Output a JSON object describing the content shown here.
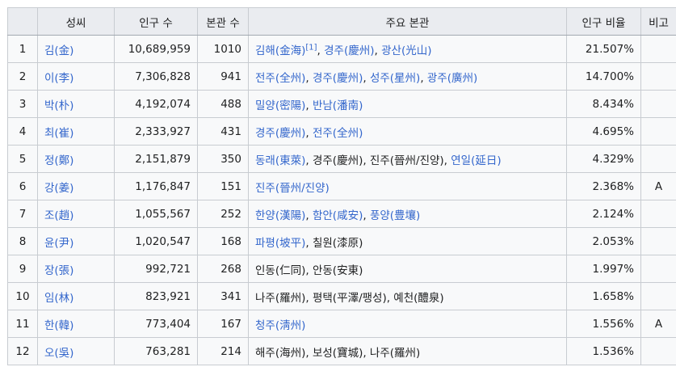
{
  "headers": [
    "",
    "성씨",
    "인구 수",
    "본관 수",
    "주요 본관",
    "인구 비율",
    "비고"
  ],
  "rows": [
    {
      "rank": "1",
      "surname": "김(金)",
      "population": "10,689,959",
      "bongwan_count": "1010",
      "main": [
        {
          "t": "김해(金海)",
          "link": true,
          "sup": "[1]"
        },
        {
          "t": ", "
        },
        {
          "t": "경주(慶州)",
          "link": true
        },
        {
          "t": ", "
        },
        {
          "t": "광산(光山)",
          "link": true
        }
      ],
      "ratio": "21.507%",
      "note": ""
    },
    {
      "rank": "2",
      "surname": "이(李)",
      "population": "7,306,828",
      "bongwan_count": "941",
      "main": [
        {
          "t": "전주(全州)",
          "link": true
        },
        {
          "t": ", "
        },
        {
          "t": "경주(慶州)",
          "link": true
        },
        {
          "t": ", "
        },
        {
          "t": "성주(星州)",
          "link": true
        },
        {
          "t": ", "
        },
        {
          "t": "광주(廣州)",
          "link": true
        }
      ],
      "ratio": "14.700%",
      "note": ""
    },
    {
      "rank": "3",
      "surname": "박(朴)",
      "population": "4,192,074",
      "bongwan_count": "488",
      "main": [
        {
          "t": "밀양(密陽)",
          "link": true
        },
        {
          "t": ", "
        },
        {
          "t": "반남(潘南)",
          "link": true
        }
      ],
      "ratio": "8.434%",
      "note": ""
    },
    {
      "rank": "4",
      "surname": "최(崔)",
      "population": "2,333,927",
      "bongwan_count": "431",
      "main": [
        {
          "t": "경주(慶州)",
          "link": true
        },
        {
          "t": ", "
        },
        {
          "t": "전주(全州)",
          "link": true
        }
      ],
      "ratio": "4.695%",
      "note": ""
    },
    {
      "rank": "5",
      "surname": "정(鄭)",
      "population": "2,151,879",
      "bongwan_count": "350",
      "main": [
        {
          "t": "동래(東萊)",
          "link": true
        },
        {
          "t": ", 경주(慶州), 진주(晉州/진양), "
        },
        {
          "t": "연일(延日)",
          "link": true
        }
      ],
      "ratio": "4.329%",
      "note": ""
    },
    {
      "rank": "6",
      "surname": "강(姜)",
      "population": "1,176,847",
      "bongwan_count": "151",
      "main": [
        {
          "t": "진주(晉州/진양)",
          "link": true
        }
      ],
      "ratio": "2.368%",
      "note": "A"
    },
    {
      "rank": "7",
      "surname": "조(趙)",
      "population": "1,055,567",
      "bongwan_count": "252",
      "main": [
        {
          "t": "한양(漢陽)",
          "link": true
        },
        {
          "t": ", "
        },
        {
          "t": "함안(咸安)",
          "link": true
        },
        {
          "t": ", "
        },
        {
          "t": "풍양(豊壤)",
          "link": true
        }
      ],
      "ratio": "2.124%",
      "note": ""
    },
    {
      "rank": "8",
      "surname": "윤(尹)",
      "population": "1,020,547",
      "bongwan_count": "168",
      "main": [
        {
          "t": "파평(坡平)",
          "link": true
        },
        {
          "t": ", 칠원(漆原)"
        }
      ],
      "ratio": "2.053%",
      "note": ""
    },
    {
      "rank": "9",
      "surname": "장(張)",
      "population": "992,721",
      "bongwan_count": "268",
      "main": [
        {
          "t": "인동(仁同), 안동(安東)"
        }
      ],
      "ratio": "1.997%",
      "note": ""
    },
    {
      "rank": "10",
      "surname": "임(林)",
      "population": "823,921",
      "bongwan_count": "341",
      "main": [
        {
          "t": "나주(羅州), 평택(平澤/팽성), 예천(醴泉)"
        }
      ],
      "ratio": "1.658%",
      "note": ""
    },
    {
      "rank": "11",
      "surname": "한(韓)",
      "population": "773,404",
      "bongwan_count": "167",
      "main": [
        {
          "t": "청주(淸州)",
          "link": true
        }
      ],
      "ratio": "1.556%",
      "note": "A"
    },
    {
      "rank": "12",
      "surname": "오(吳)",
      "population": "763,281",
      "bongwan_count": "214",
      "main": [
        {
          "t": "해주(海州), 보성(寶城), 나주(羅州)"
        }
      ],
      "ratio": "1.536%",
      "note": ""
    }
  ]
}
